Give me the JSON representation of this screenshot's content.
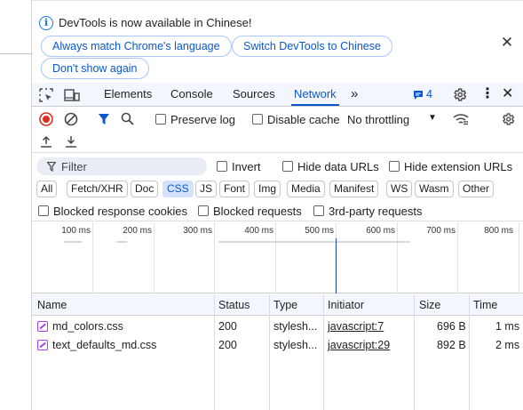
{
  "banner": {
    "message": "DevTools is now available in Chinese!",
    "buttons": [
      "Always match Chrome's language",
      "Switch DevTools to Chinese",
      "Don't show again"
    ]
  },
  "tabs": {
    "items": [
      "Elements",
      "Console",
      "Sources",
      "Network"
    ],
    "active": "Network",
    "issues_count": "4"
  },
  "toolbar": {
    "preserve_log": "Preserve log",
    "disable_cache": "Disable cache",
    "throttling": "No throttling"
  },
  "filter": {
    "placeholder": "Filter",
    "invert": "Invert",
    "hide_data_urls": "Hide data URLs",
    "hide_extension_urls": "Hide extension URLs"
  },
  "type_filters": [
    "All",
    "Fetch/XHR",
    "Doc",
    "CSS",
    "JS",
    "Font",
    "Img",
    "Media",
    "Manifest",
    "WS",
    "Wasm",
    "Other"
  ],
  "active_type_filter": "CSS",
  "request_filters": {
    "blocked_cookies": "Blocked response cookies",
    "blocked_requests": "Blocked requests",
    "third_party": "3rd-party requests"
  },
  "timeline": {
    "ticks": [
      "100 ms",
      "200 ms",
      "300 ms",
      "400 ms",
      "500 ms",
      "600 ms",
      "700 ms",
      "800 ms"
    ]
  },
  "table": {
    "columns": [
      "Name",
      "Status",
      "Type",
      "Initiator",
      "Size",
      "Time"
    ],
    "rows": [
      {
        "name": "md_colors.css",
        "status": "200",
        "type": "stylesh...",
        "initiator": "javascript:7",
        "size": "696 B",
        "time": "1 ms"
      },
      {
        "name": "text_defaults_md.css",
        "status": "200",
        "type": "stylesh...",
        "initiator": "javascript:29",
        "size": "892 B",
        "time": "2 ms"
      }
    ]
  },
  "colors": {
    "accent": "#0b57d0",
    "record": "#d93025",
    "css_icon": "#a142f4"
  }
}
